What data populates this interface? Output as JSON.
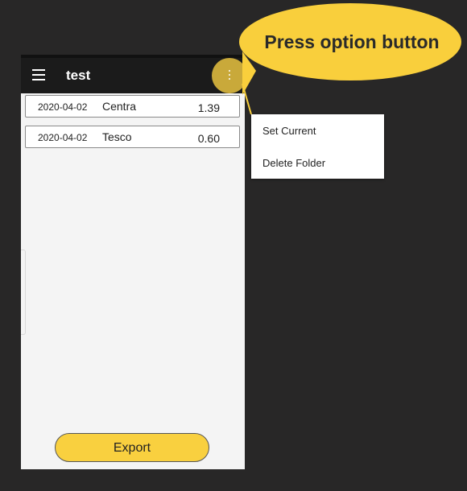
{
  "app": {
    "title": "test"
  },
  "receipts": [
    {
      "date": "2020-04-02",
      "store": "Centra",
      "amount": "1.39"
    },
    {
      "date": "2020-04-02",
      "store": "Tesco",
      "amount": "0.60"
    }
  ],
  "footer": {
    "export_label": "Export"
  },
  "options_menu": {
    "items": [
      "Set Current",
      "Delete Folder"
    ]
  },
  "callout": {
    "text": "Press option button"
  },
  "icons": {
    "menu": "hamburger-menu-icon",
    "options": "more-vert-icon"
  },
  "colors": {
    "background": "#282727",
    "app_bar": "#1b1b1b",
    "callout_fill": "#f9cf3c",
    "highlight": "#c9a93a",
    "export_button": "#f9d03f"
  }
}
